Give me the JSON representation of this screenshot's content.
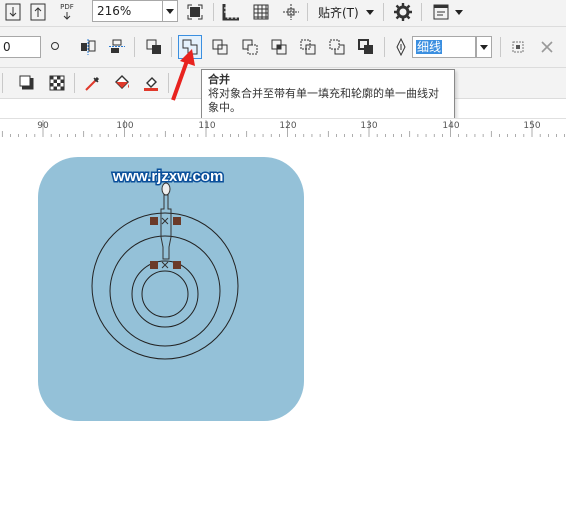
{
  "toolbar_top": {
    "zoom_value": "216%",
    "pdf_label": "PDF",
    "snap_label": "贴齐(T)",
    "icons": [
      "import-icon",
      "export-icon",
      "publish-pdf-icon",
      "zoom-dropdown-icon",
      "full-screen-icon",
      "show-rulers-icon",
      "show-grid-icon",
      "show-guidelines-icon",
      "snap-dropdown-icon",
      "options-gear-icon",
      "application-launcher-icon"
    ]
  },
  "toolbar_props": {
    "left_field_value": "0",
    "outline_width_value": "细线",
    "icons": [
      "group-icon",
      "ungroup-icon",
      "combine-icon",
      "weld-icon",
      "trim-icon",
      "intersect-icon",
      "simplify-icon",
      "front-minus-back-icon",
      "back-minus-front-icon",
      "boundary-icon",
      "pen-nib-icon",
      "convert-to-curves-icon",
      "close-icon"
    ]
  },
  "tooltip": {
    "title": "合并",
    "description": "将对象合并至带有单一填充和轮廓的单一曲线对象中。"
  },
  "ruler": {
    "ticks": [
      "90",
      "100",
      "110",
      "120",
      "130",
      "140",
      "150"
    ]
  },
  "canvas": {
    "watermark": "www.rjzxw.com",
    "card_color": "#94c1d8",
    "mark_color": "#6b3a28"
  }
}
